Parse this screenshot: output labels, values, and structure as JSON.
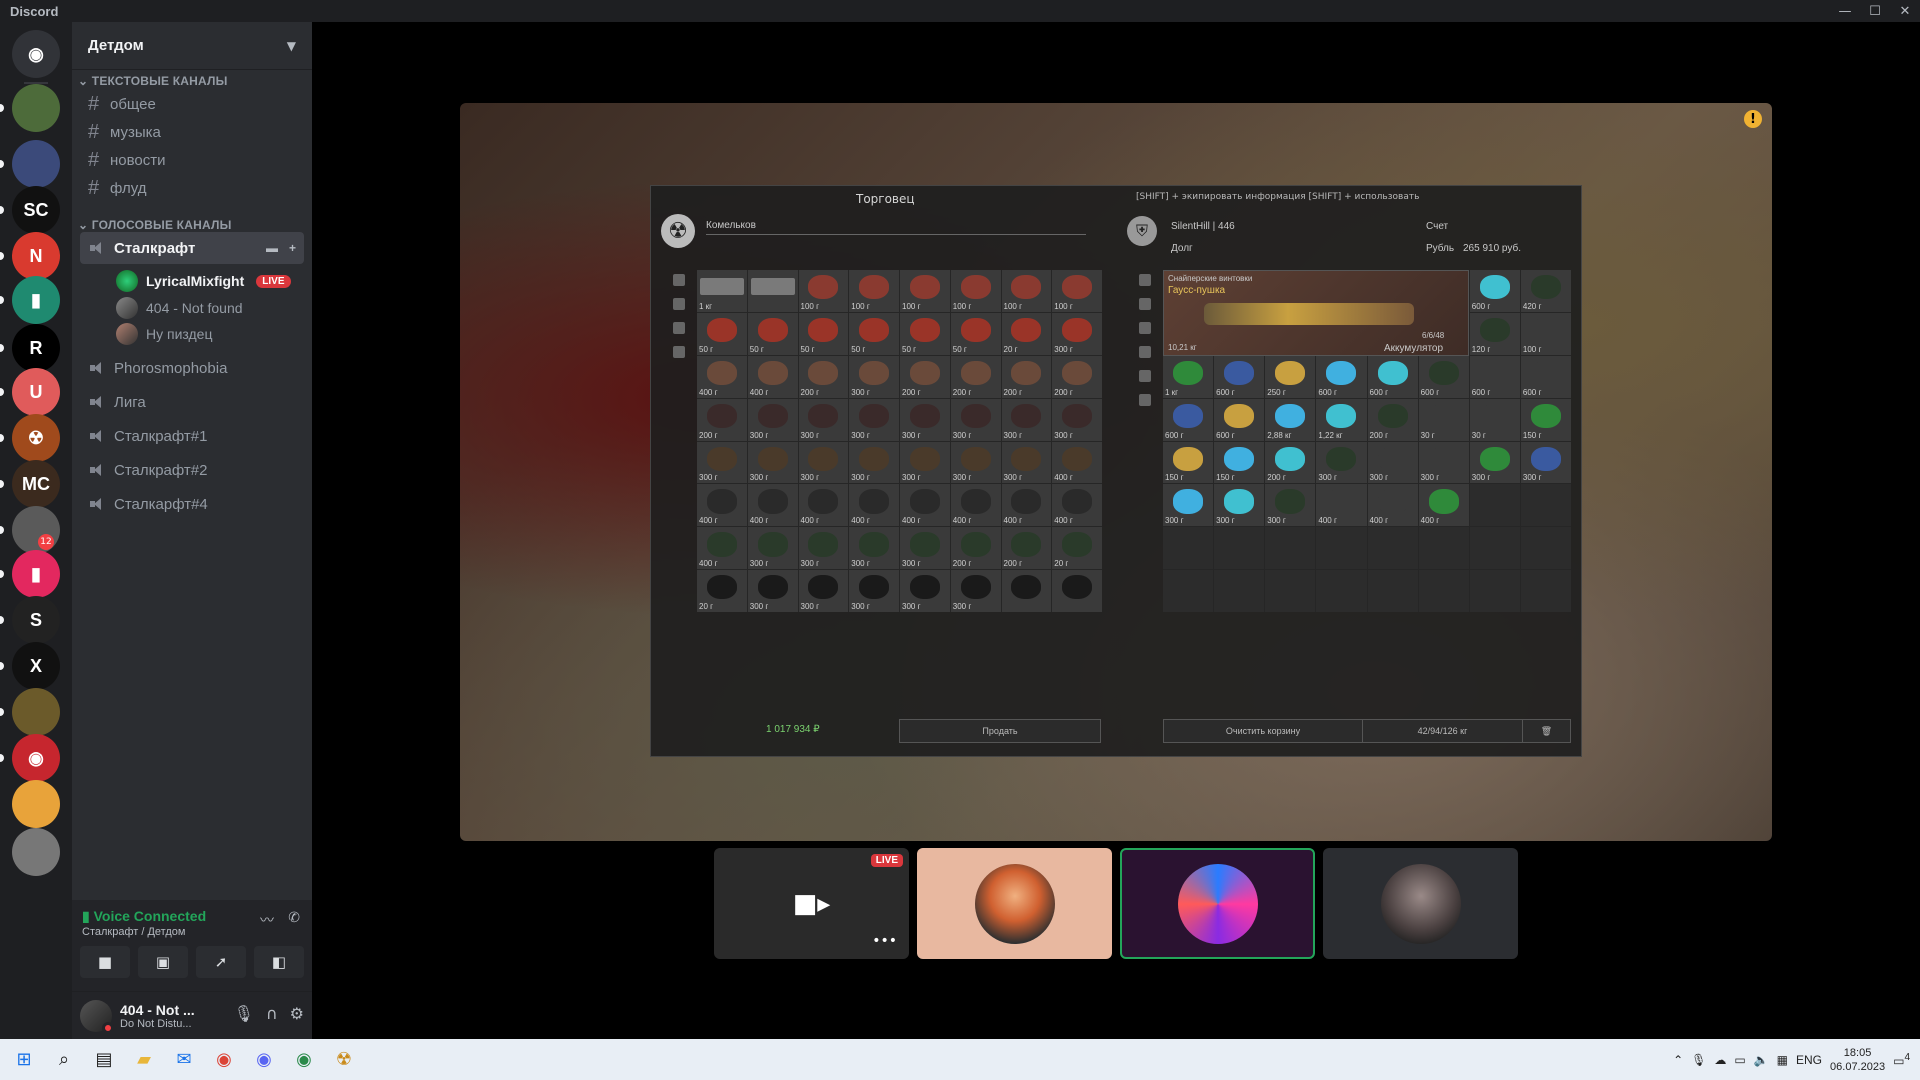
{
  "app": {
    "title": "Discord"
  },
  "window_controls": {
    "minimize": "—",
    "maximize": "☐",
    "close": "✕"
  },
  "guilds": [
    {
      "name": "discord-home",
      "color": "#313338",
      "glyph": "◉"
    },
    {
      "name": "server-1",
      "color": "#4d6b3a",
      "glyph": ""
    },
    {
      "name": "server-2",
      "color": "#3b4a7a",
      "glyph": ""
    },
    {
      "name": "server-sc",
      "color": "#111111",
      "glyph": "SC"
    },
    {
      "name": "server-ng",
      "color": "#d93a2f",
      "glyph": "N"
    },
    {
      "name": "server-green",
      "color": "#1f8a70",
      "glyph": "▮"
    },
    {
      "name": "server-r",
      "color": "#000000",
      "glyph": "R"
    },
    {
      "name": "server-u",
      "color": "#e05b5b",
      "glyph": "U"
    },
    {
      "name": "server-radiation",
      "color": "#a04a1c",
      "glyph": "☢"
    },
    {
      "name": "server-minecraft",
      "color": "#3b2a1e",
      "glyph": "MC"
    },
    {
      "name": "server-group",
      "color": "#5a5a5a",
      "glyph": ""
    },
    {
      "name": "server-pink",
      "color": "#e3285f",
      "glyph": "▮"
    },
    {
      "name": "server-s",
      "color": "#222222",
      "glyph": "S"
    },
    {
      "name": "server-xray",
      "color": "#111111",
      "glyph": "X"
    },
    {
      "name": "server-stalker",
      "color": "#6b5a2a",
      "glyph": ""
    },
    {
      "name": "server-red-robot",
      "color": "#c6262e",
      "glyph": "◉"
    },
    {
      "name": "server-anime",
      "color": "#e8a33a",
      "glyph": ""
    },
    {
      "name": "server-gray",
      "color": "#777777",
      "glyph": ""
    }
  ],
  "guild_badge": "12",
  "server": {
    "name": "Детдом"
  },
  "text_category": "ТЕКСТОВЫЕ КАНАЛЫ",
  "text_channels": [
    "общее",
    "музыка",
    "новости",
    "флуд"
  ],
  "voice_category": "ГОЛОСОВЫЕ КАНАЛЫ",
  "active_voice": "Сталкрафт",
  "voice_users": [
    {
      "name": "LyricalMixfight",
      "live": "LIVE"
    },
    {
      "name": "404 - Not found",
      "live": ""
    },
    {
      "name": "Ну пиздец",
      "live": ""
    }
  ],
  "voice_channels": [
    "Phorosmophobia",
    "Лига",
    "Сталкрафт#1",
    "Сталкрафт#2",
    "Сталкарфт#4"
  ],
  "voice_status": {
    "title": "Voice Connected",
    "subtitle": "Сталкрафт / Детдом"
  },
  "user": {
    "name": "404 - Not ...",
    "status": "Do Not Distu..."
  },
  "game": {
    "title": "Торговец",
    "hints": "[SHIFT] +  экипировать     информация    [SHIFT] +  использовать",
    "trader_name": "Комельков",
    "player": "SilentHill | 446",
    "account_label": "Счет",
    "debt_label": "Долг",
    "ruble_label": "Рубль",
    "ruble_value": "265 910 руб.",
    "weapon_category": "Снайперские винтовки",
    "weapon_name": "Гаусс-пушка",
    "weapon_weight": "10,21 кг",
    "weapon_ammo": "6/6/48",
    "weapon_part": "Аккумулятор",
    "balance": "1 017 934",
    "sell_button": "Продать",
    "clear_button": "Очистить корзину",
    "weight": "42/94/126 кг",
    "left_prices": [
      "1 кг",
      "",
      "100 г",
      "100 г",
      "100 г",
      "100 г",
      "100 г",
      "100 г",
      "50 г",
      "50 г",
      "50 г",
      "50 г",
      "50 г",
      "50 г",
      "20 г",
      "300 г",
      "400 г",
      "400 г",
      "200 г",
      "300 г",
      "200 г",
      "200 г",
      "200 г",
      "200 г",
      "200 г",
      "300 г",
      "300 г",
      "300 г",
      "300 г",
      "300 г",
      "300 г",
      "300 г",
      "300 г",
      "300 г",
      "300 г",
      "300 г",
      "300 г",
      "300 г",
      "300 г",
      "400 г",
      "400 г",
      "400 г",
      "400 г",
      "400 г",
      "400 г",
      "400 г",
      "400 г",
      "400 г",
      "400 г",
      "300 г",
      "300 г",
      "300 г",
      "300 г",
      "200 г",
      "200 г",
      "20 г",
      "20 г",
      "300 г",
      "300 г",
      "300 г",
      "300 г",
      "300 г"
    ],
    "right_prices": [
      "",
      "",
      "",
      "",
      "",
      "",
      "600 г",
      "420 г",
      "",
      "",
      "",
      "",
      "",
      "",
      "120 г",
      "100 г",
      "1 кг",
      "600 г",
      "250 г",
      "600 г",
      "600 г",
      "600 г",
      "600 г",
      "600 г",
      "600 г",
      "600 г",
      "2,88 кг",
      "1,22 кг",
      "200 г",
      "30 г",
      "30 г",
      "150 г",
      "150 г",
      "150 г",
      "200 г",
      "300 г",
      "300 г",
      "300 г",
      "300 г",
      "300 г",
      "300 г",
      "300 г",
      "300 г",
      "400 г",
      "400 г",
      "400 г"
    ]
  },
  "tiles": [
    {
      "name": "stream-tile",
      "bg": "#2a2a2a",
      "live": "LIVE"
    },
    {
      "name": "user-tile-1",
      "bg": "#e8b8a0",
      "live": ""
    },
    {
      "name": "user-tile-2",
      "bg": "#2a1230",
      "live": ""
    },
    {
      "name": "user-tile-3",
      "bg": "#2b2d31",
      "live": ""
    }
  ],
  "taskbar": {
    "lang": "ENG",
    "time": "18:05",
    "date": "06.07.2023",
    "notif": "4",
    "mail_badge": "4"
  }
}
